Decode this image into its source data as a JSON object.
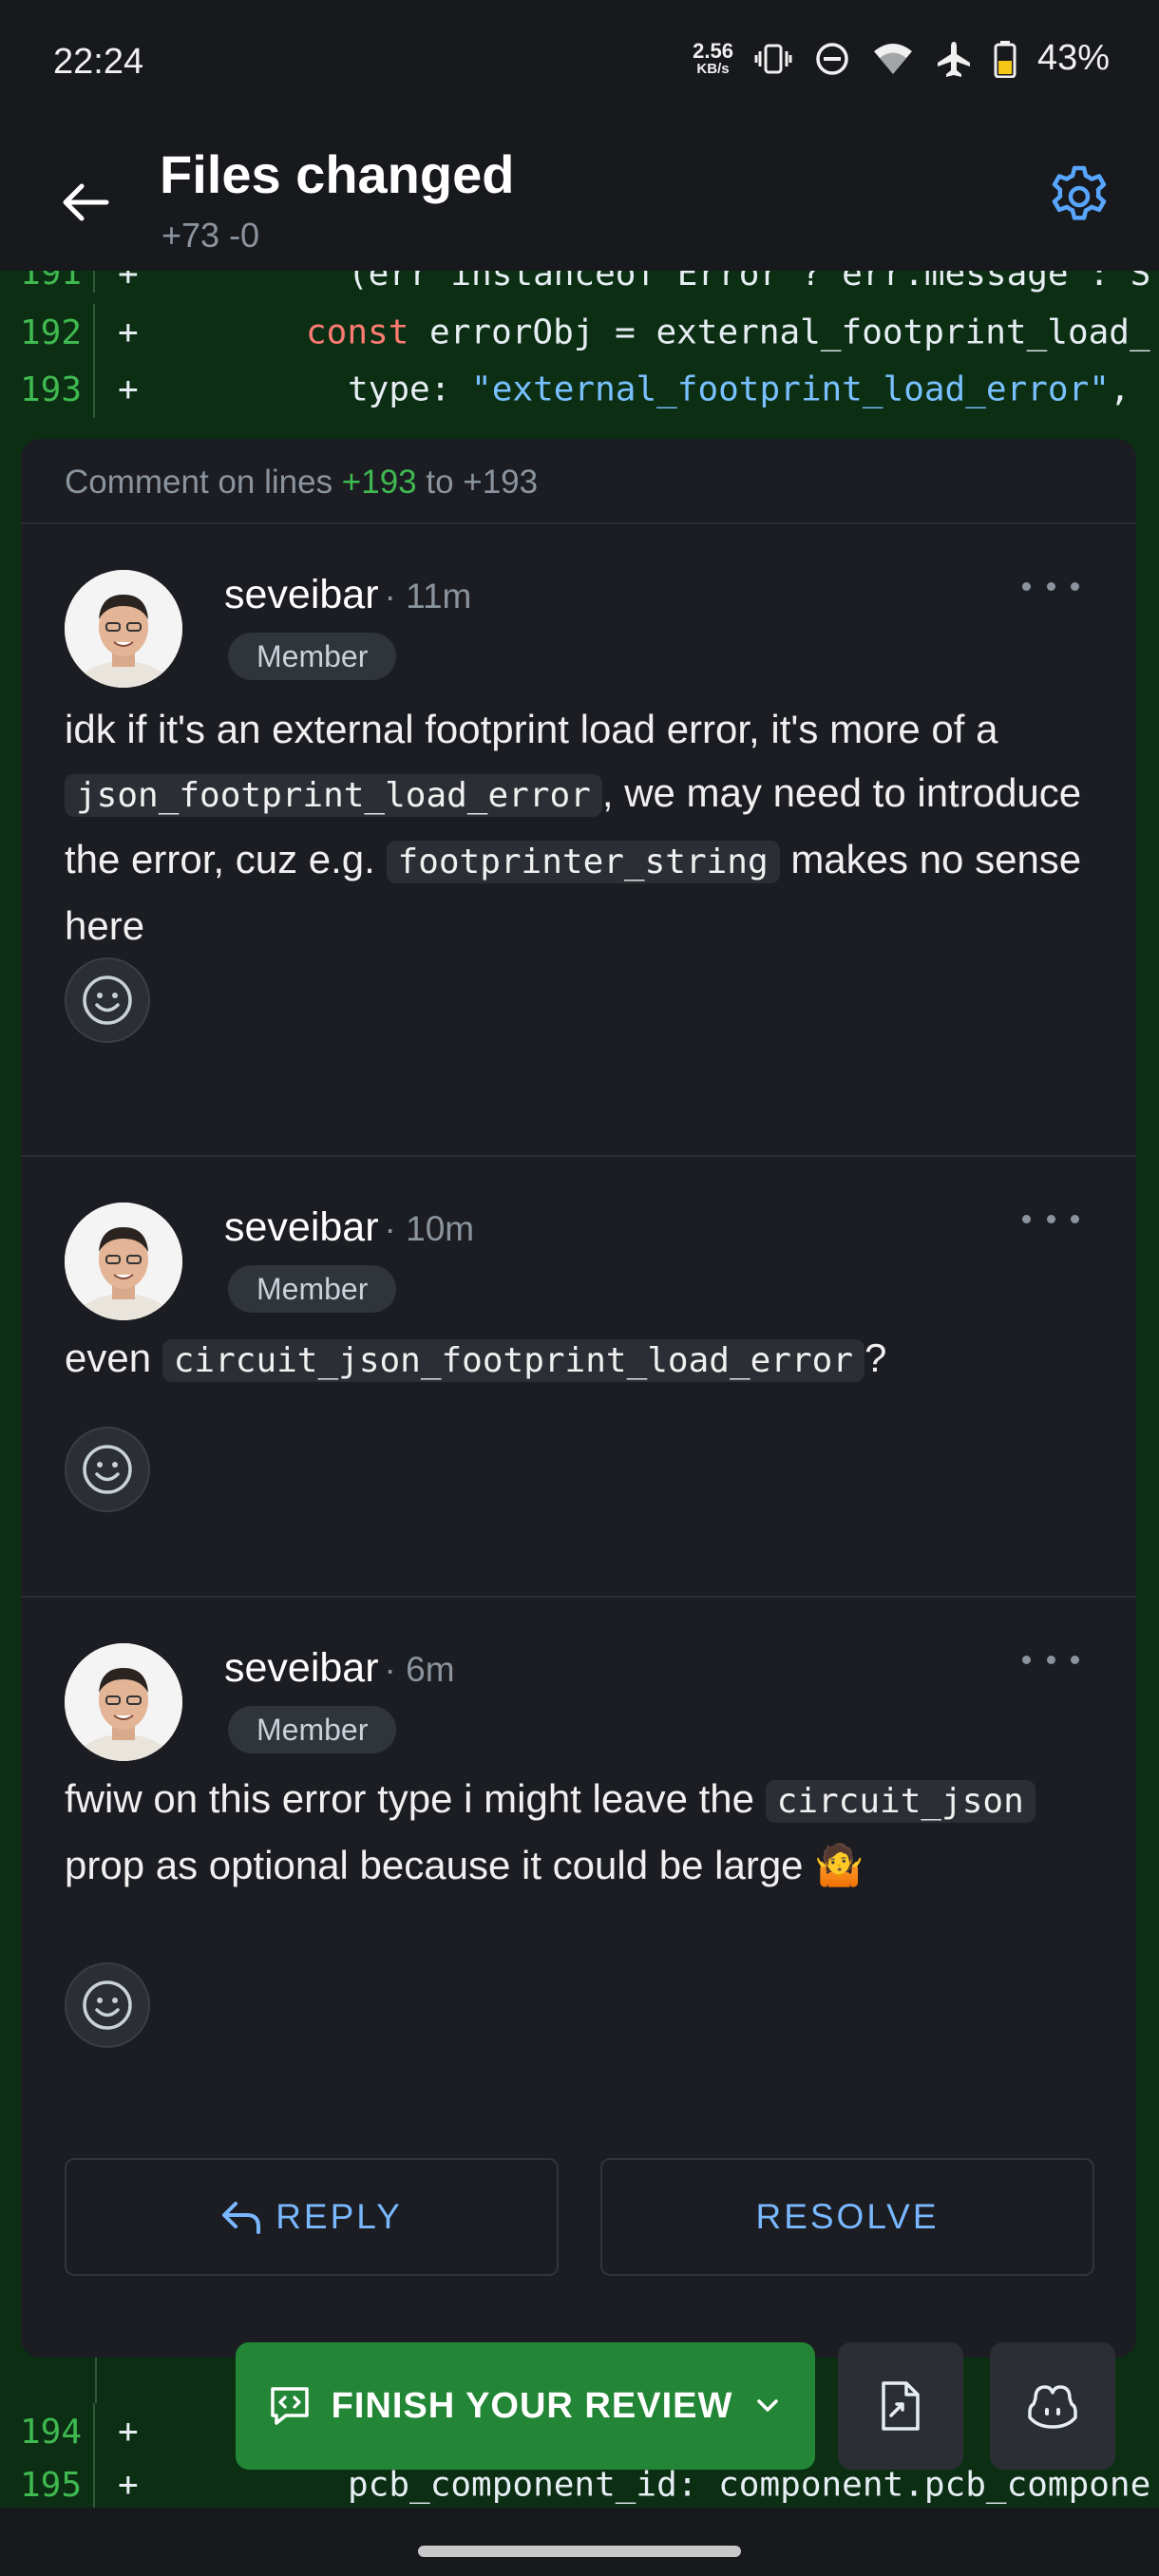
{
  "status_bar": {
    "time": "22:24",
    "net_speed_value": "2.56",
    "net_speed_unit": "KB/s",
    "battery_percent": "43%",
    "icons": [
      "vibrate-icon",
      "dnd-icon",
      "wifi-icon",
      "airplane-icon",
      "battery-icon"
    ]
  },
  "header": {
    "title": "Files changed",
    "subtitle": "+73 -0"
  },
  "diff_top": [
    {
      "line": "191",
      "sign": "+",
      "text": "(err instanceof Error ? err.message : S"
    },
    {
      "line": "192",
      "sign": "+",
      "keyword": "const",
      "text": " errorObj = external_footprint_load_"
    },
    {
      "line": "193",
      "sign": "+",
      "prefix": "type: ",
      "string": "\"external_footprint_load_error\"",
      "suffix": ","
    }
  ],
  "thread": {
    "header_prefix": "Comment on lines ",
    "header_from": "+193",
    "header_mid": " to ",
    "header_to": "+193",
    "comments": [
      {
        "author": "seveibar",
        "time": "· 11m",
        "badge": "Member",
        "body_1": "idk if it's an external footprint load error, it's more of a ",
        "code_1": "json_footprint_load_error",
        "body_2": ", we may need to introduce the error, cuz e.g. ",
        "code_2": "footprinter_string",
        "body_3": " makes no sense here"
      },
      {
        "author": "seveibar",
        "time": "· 10m",
        "badge": "Member",
        "body_1": "even ",
        "code_1": "circuit_json_footprint_load_error",
        "body_2": "?"
      },
      {
        "author": "seveibar",
        "time": "· 6m",
        "badge": "Member",
        "body_1": "fwiw on this error type i might leave the ",
        "code_1": "circuit_json",
        "body_2": " prop as optional because it could be large 🤷"
      }
    ],
    "reply_label": "REPLY",
    "resolve_label": "RESOLVE"
  },
  "diff_bottom": [
    {
      "line": "194",
      "sign": "+",
      "text": ""
    },
    {
      "line": "195",
      "sign": "+",
      "text": "pcb_component_id: component.pcb_compone"
    }
  ],
  "bottom_bar": {
    "finish_review_label": "FINISH YOUR REVIEW"
  },
  "colors": {
    "accent": "#79b8ff",
    "finish_green": "#238636",
    "diff_add_bg": "#0c2f14",
    "line_number": "#3fb950"
  }
}
